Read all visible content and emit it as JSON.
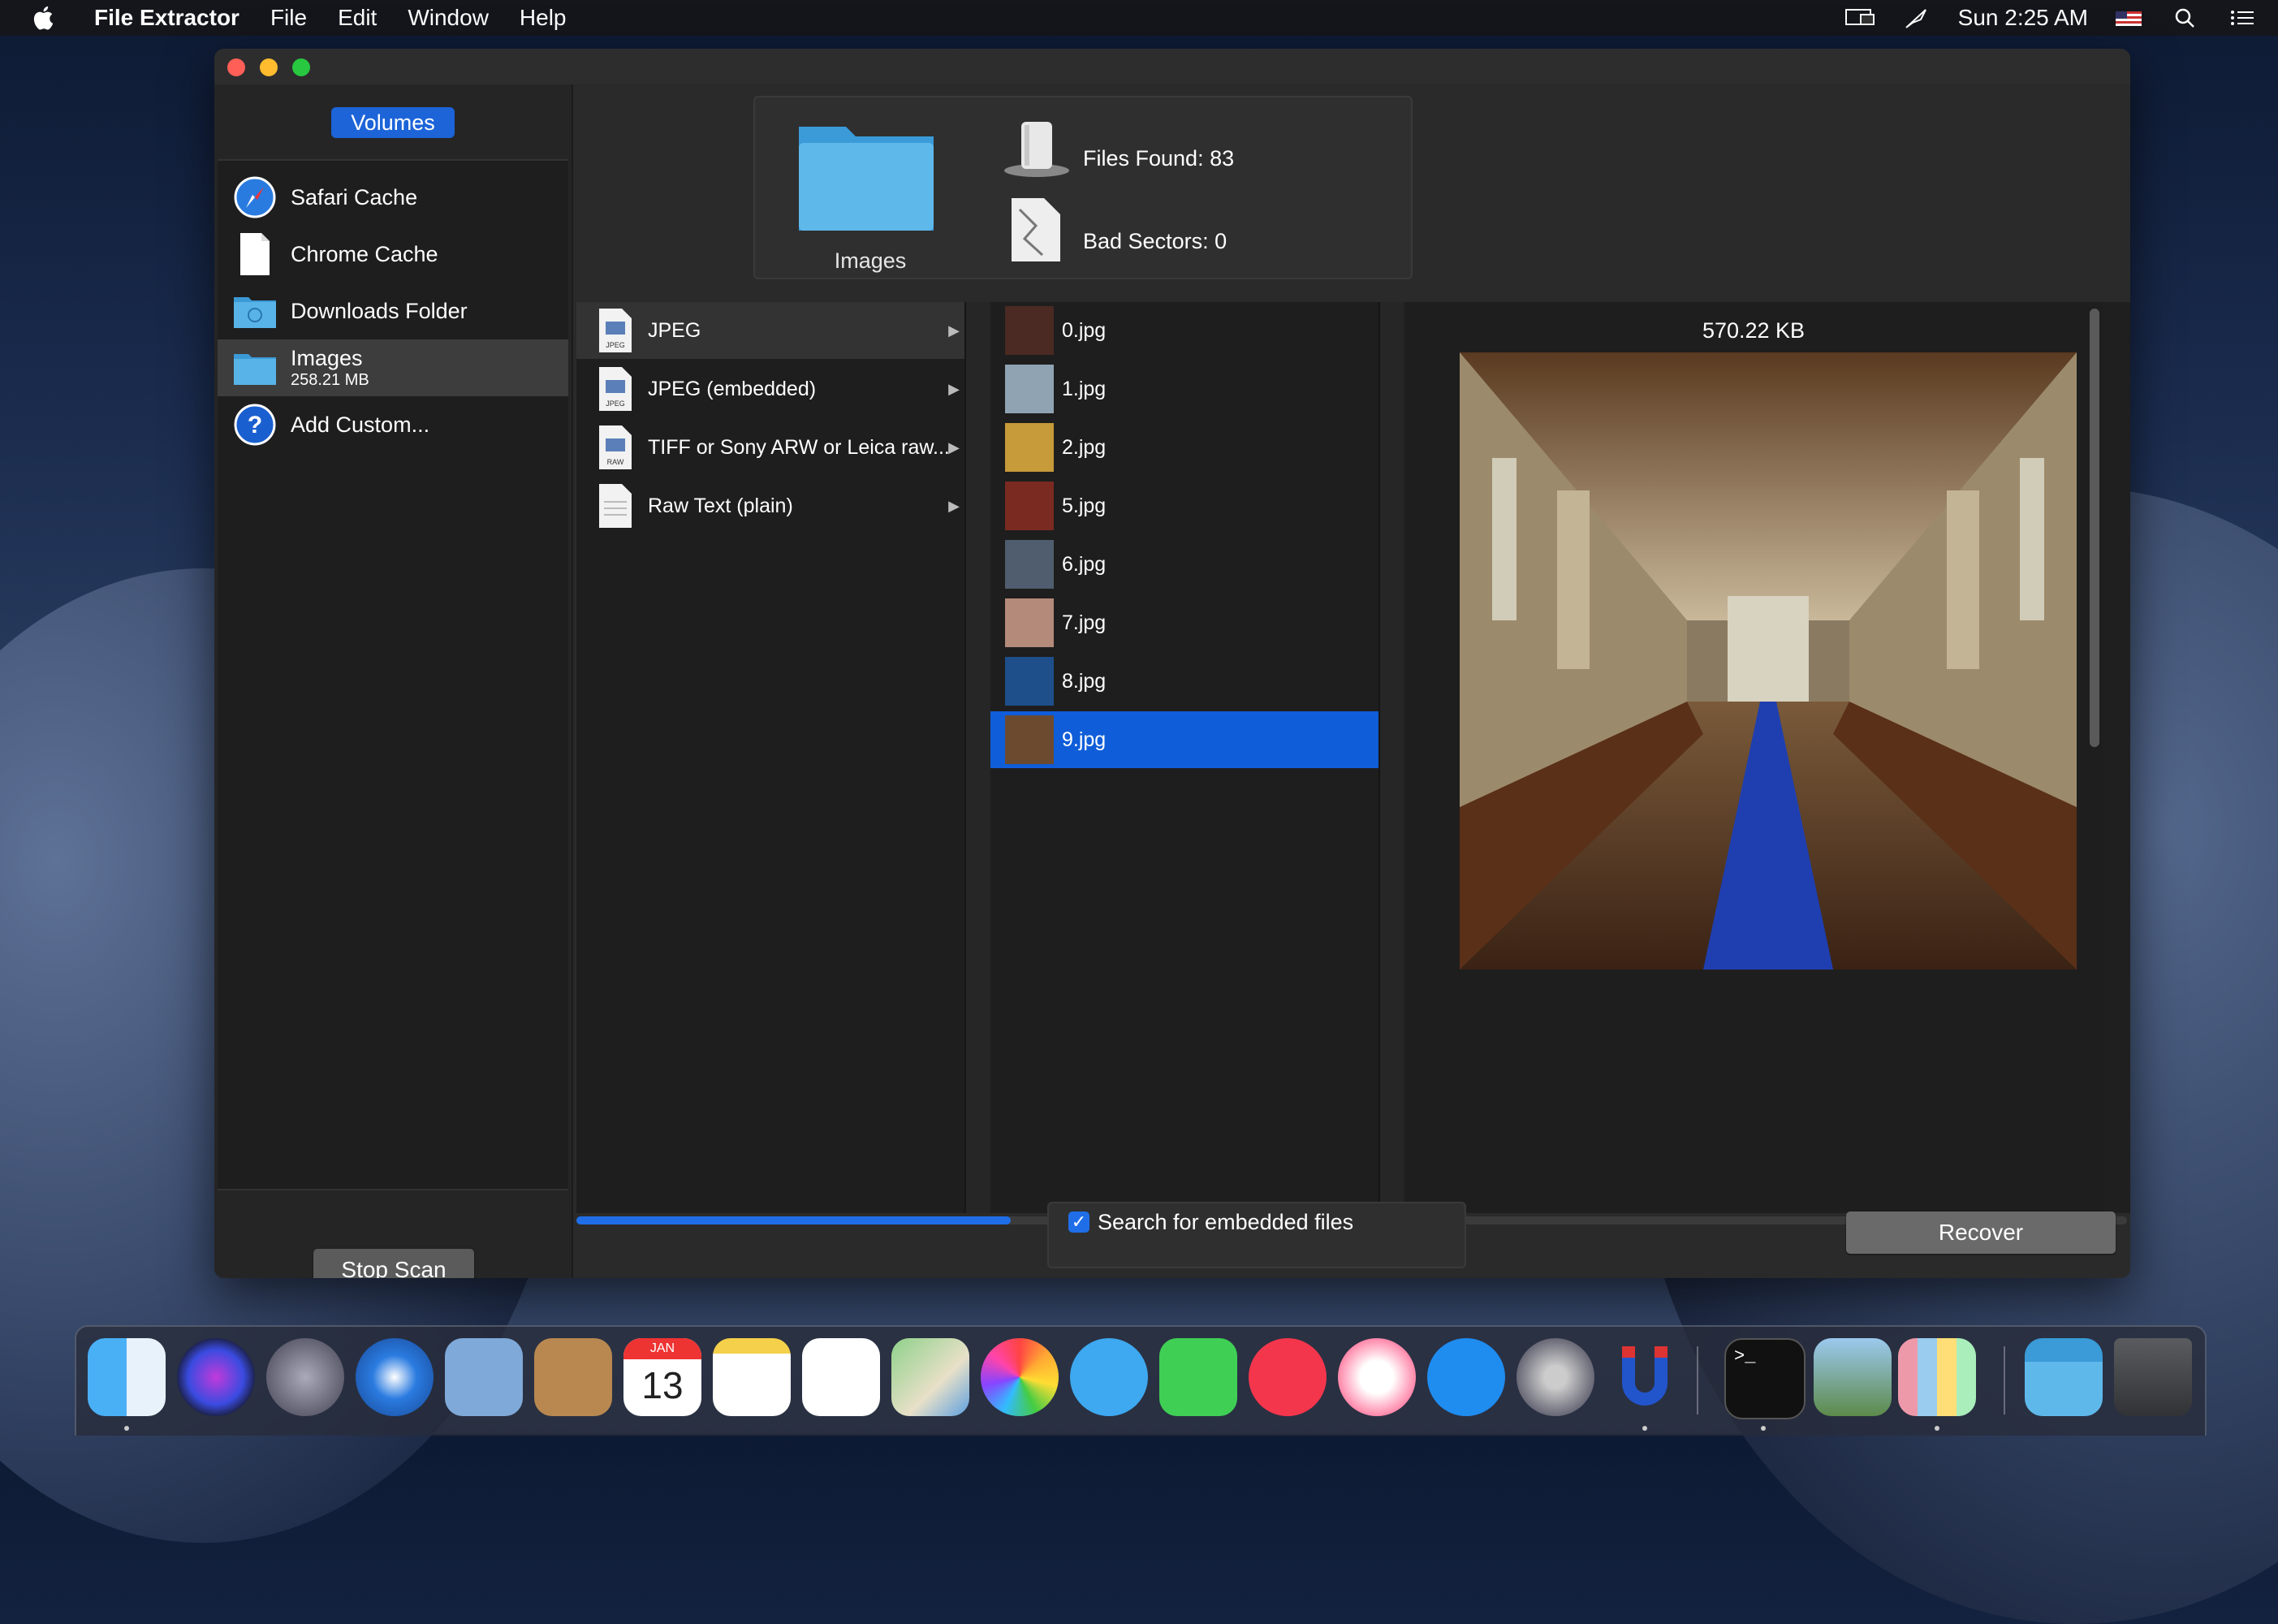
{
  "menubar": {
    "app_name": "File Extractor",
    "menus": [
      "File",
      "Edit",
      "Window",
      "Help"
    ],
    "clock": "Sun 2:25 AM"
  },
  "sidebar": {
    "header": "Volumes",
    "items": [
      {
        "label": "Safari Cache",
        "icon": "safari-compass-icon"
      },
      {
        "label": "Chrome Cache",
        "icon": "document-icon"
      },
      {
        "label": "Downloads Folder",
        "icon": "downloads-folder-icon"
      },
      {
        "label": "Images",
        "sublabel": "258.21 MB",
        "icon": "folder-icon",
        "selected": true
      },
      {
        "label": "Add Custom...",
        "icon": "question-icon"
      }
    ],
    "stop_button": "Stop Scan"
  },
  "summary": {
    "folder_label": "Images",
    "files_found_label": "Files Found:",
    "files_found_value": "83",
    "bad_sectors_label": "Bad Sectors:",
    "bad_sectors_value": "0"
  },
  "file_types": [
    {
      "label": "JPEG",
      "badge": "JPEG",
      "selected": true
    },
    {
      "label": "JPEG (embedded)",
      "badge": "JPEG"
    },
    {
      "label": "TIFF or Sony ARW or Leica raw...",
      "badge": "RAW"
    },
    {
      "label": "Raw Text (plain)",
      "badge": ""
    }
  ],
  "files": [
    {
      "name": "0.jpg",
      "color": "#4a2a22"
    },
    {
      "name": "1.jpg",
      "color": "#8fa3b3"
    },
    {
      "name": "2.jpg",
      "color": "#c79a3a"
    },
    {
      "name": "5.jpg",
      "color": "#7a2a20"
    },
    {
      "name": "6.jpg",
      "color": "#4f5d6e"
    },
    {
      "name": "7.jpg",
      "color": "#b48a7a"
    },
    {
      "name": "8.jpg",
      "color": "#1e4f8a"
    },
    {
      "name": "9.jpg",
      "color": "#6b4a30",
      "selected": true
    }
  ],
  "preview": {
    "size": "570.22 KB"
  },
  "progress": 0.28,
  "embedded_checkbox": {
    "label": "Search for embedded files",
    "checked": true
  },
  "recover_button": "Recover",
  "colors": {
    "accent": "#1f6ee8",
    "selection": "#0f5dd9"
  },
  "dock": [
    "finder-icon",
    "siri-icon",
    "launchpad-icon",
    "safari-icon",
    "mail-icon",
    "contacts-icon",
    "calendar-icon",
    "notes-icon",
    "reminders-icon",
    "maps-icon",
    "photos-icon",
    "messages-icon",
    "facetime-icon",
    "news-icon",
    "music-icon",
    "app-store-icon",
    "system-preferences-icon",
    "file-extractor-magnet-icon",
    "terminal-icon",
    "preview-icon",
    "app-grid-icon",
    "downloads-stack-icon",
    "trash-icon"
  ],
  "calendar_month": "JAN",
  "calendar_day": "13"
}
